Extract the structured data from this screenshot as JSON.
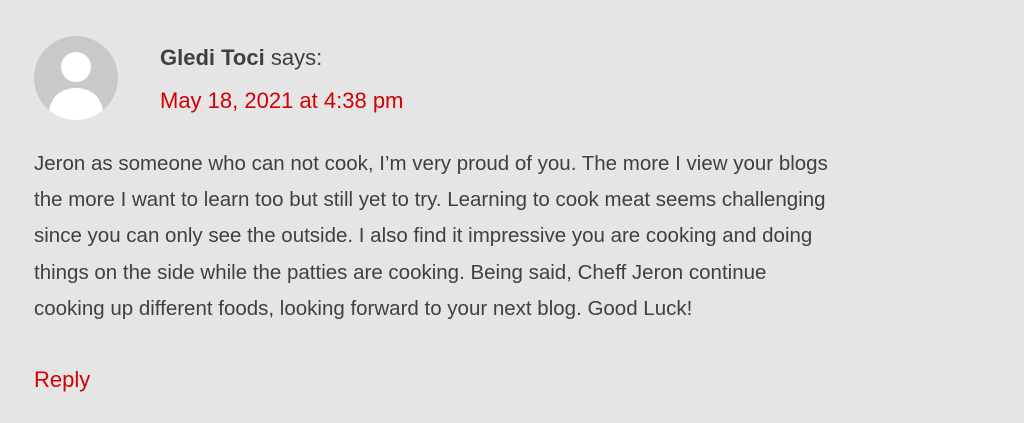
{
  "comment": {
    "author": "Gledi Toci",
    "says": "says:",
    "date": "May 18, 2021 at 4:38 pm",
    "body_lines": [
      "Jeron as someone who can not cook, I’m very proud of you. The more I view your blogs",
      "the more I want to learn too but still yet to try. Learning to cook meat seems challenging",
      "since you can only see the outside. I also find it impressive you are cooking and doing",
      "things on the side while the patties are cooking. Being said, Cheff Jeron continue",
      "cooking up different foods, looking forward to your next blog. Good Luck!"
    ],
    "reply_label": "Reply",
    "avatar_icon": "default-user-avatar-icon"
  },
  "colors": {
    "background": "#e5e5e5",
    "text": "#404040",
    "link": "#d40000",
    "avatar_bg": "#c9c9c9"
  }
}
